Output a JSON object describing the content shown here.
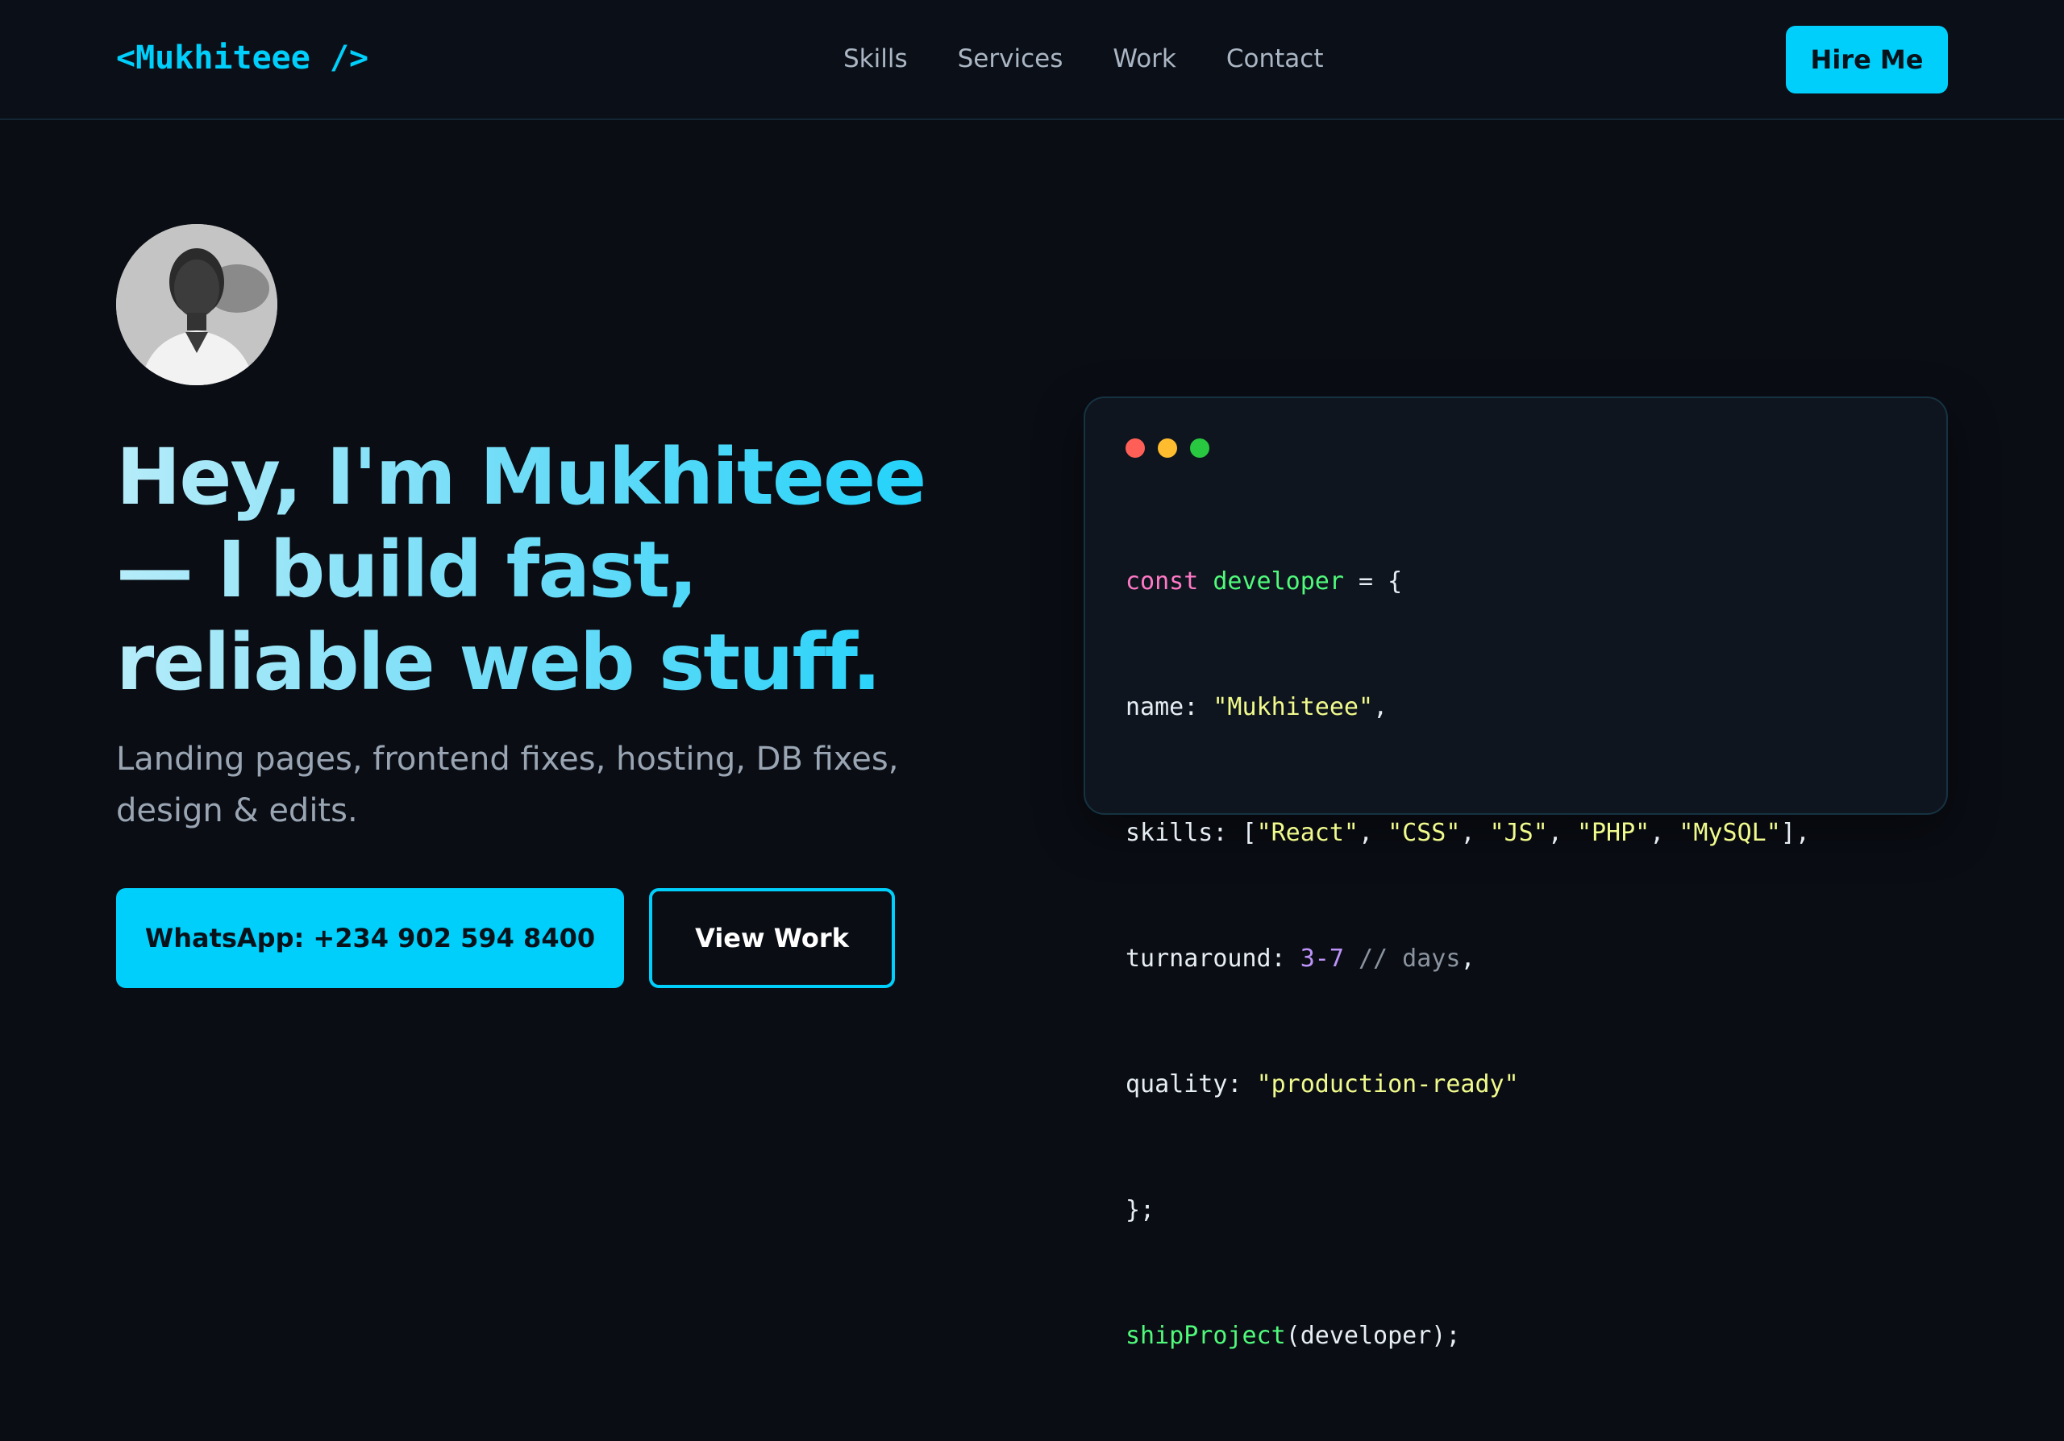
{
  "header": {
    "logo": "<Mukhiteee />",
    "nav": [
      "Skills",
      "Services",
      "Work",
      "Contact"
    ],
    "hire_label": "Hire Me"
  },
  "hero": {
    "title": "Hey, I'm Mukhiteee — I build fast, reliable web stuff.",
    "subtitle": "Landing pages, frontend fixes, hosting, DB fixes, design & edits.",
    "whatsapp_label": "WhatsApp: +234 902 594 8400",
    "view_work_label": "View Work"
  },
  "code": {
    "line1": {
      "kw": "const",
      "fn": "developer",
      "rest": " = {"
    },
    "line2": {
      "key": "name: ",
      "str": "\"Mukhiteee\"",
      "rest": ","
    },
    "line3": {
      "key": "skills: [",
      "s1": "\"React\"",
      "s2": "\"CSS\"",
      "s3": "\"JS\"",
      "s4": "\"PHP\"",
      "s5": "\"MySQL\"",
      "sep": ", ",
      "rest": "],"
    },
    "line4": {
      "key": "turnaround: ",
      "num": "3-7",
      "cmt": " // days",
      "rest": ","
    },
    "line5": {
      "key": "quality: ",
      "str": "\"production-ready\""
    },
    "line6": {
      "text": "};"
    },
    "line7": {
      "fn": "shipProject",
      "rest": "(developer);"
    }
  },
  "colors": {
    "accent": "#00cffc",
    "background": "#0a0d14",
    "card": "#0f151e"
  }
}
